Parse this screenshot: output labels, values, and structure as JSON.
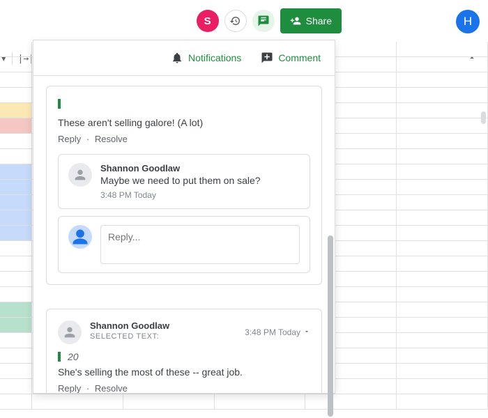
{
  "toolbar": {
    "avatar_s_initial": "S",
    "share_label": "Share",
    "avatar_h_initial": "H"
  },
  "panel": {
    "notifications_label": "Notifications",
    "comment_label": "Comment"
  },
  "thread1": {
    "comment": "These aren't selling galore! (A lot)",
    "reply_label": "Reply",
    "resolve_label": "Resolve",
    "replies": [
      {
        "author": "Shannon Goodlaw",
        "text": "Maybe we need to put them on sale?",
        "time": "3:48 PM Today"
      }
    ],
    "reply_placeholder": "Reply..."
  },
  "thread2": {
    "author": "Shannon Goodlaw",
    "selected_text_label": "SELECTED TEXT:",
    "timestamp": "3:48 PM Today",
    "selected_value": "20",
    "comment": "She's selling the most of these -- great job.",
    "reply_label": "Reply",
    "resolve_label": "Resolve"
  }
}
